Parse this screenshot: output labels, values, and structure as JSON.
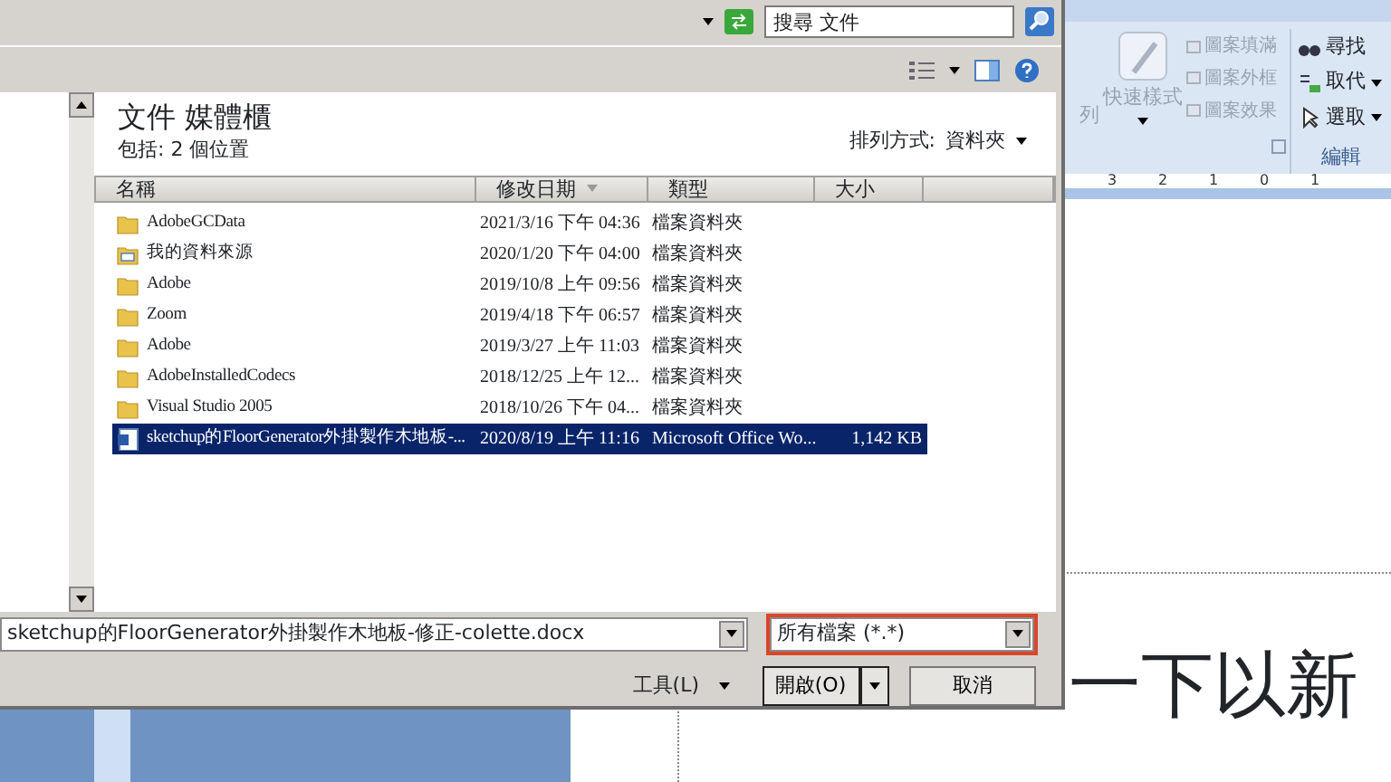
{
  "dialog": {
    "search": {
      "placeholder": "搜尋 文件"
    },
    "library": {
      "title": "文件 媒體櫃",
      "subtitle": "包括: 2 個位置",
      "arrange_label": "排列方式:",
      "arrange_value": "資料夾"
    },
    "columns": [
      {
        "label": "名稱",
        "sorted": false
      },
      {
        "label": "修改日期",
        "sorted": true
      },
      {
        "label": "類型",
        "sorted": false
      },
      {
        "label": "大小",
        "sorted": false
      }
    ],
    "rows": [
      {
        "kind": "folder",
        "name": "AdobeGCData",
        "modified": "2021/3/16 下午 04:36",
        "type": "檔案資料夾",
        "selected": false
      },
      {
        "kind": "special",
        "name": "我的資料來源",
        "modified": "2020/1/20 下午 04:00",
        "type": "檔案資料夾",
        "selected": false
      },
      {
        "kind": "folder",
        "name": "Adobe",
        "modified": "2019/10/8 上午 09:56",
        "type": "檔案資料夾",
        "selected": false
      },
      {
        "kind": "folder",
        "name": "Zoom",
        "modified": "2019/4/18 下午 06:57",
        "type": "檔案資料夾",
        "selected": false
      },
      {
        "kind": "folder",
        "name": "Adobe",
        "modified": "2019/3/27 上午 11:03",
        "type": "檔案資料夾",
        "selected": false
      },
      {
        "kind": "folder",
        "name": "AdobeInstalledCodecs",
        "modified": "2018/12/25 上午 12...",
        "type": "檔案資料夾",
        "selected": false
      },
      {
        "kind": "folder",
        "name": "Visual Studio 2005",
        "modified": "2018/10/26 下午 04...",
        "type": "檔案資料夾",
        "selected": false
      },
      {
        "kind": "document",
        "name": "sketchup的FloorGenerator外掛製作木地板-...",
        "modified": "2020/8/19 上午 11:16",
        "type": "Microsoft Office Wo...",
        "size": "1,142 KB",
        "selected": true
      }
    ],
    "file_name": {
      "value": "sketchup的FloorGenerator外掛製作木地板-修正-colette.docx"
    },
    "file_type": {
      "value": "所有檔案 (*.*)",
      "highlighted": true
    },
    "tools_button": "工具(L)",
    "open_button": "開啟(O)",
    "cancel_button": "取消"
  },
  "word": {
    "ribbon": {
      "cut_label": "列",
      "quick_styles": "快速樣式",
      "shape_items": [
        {
          "label": "圖案填滿",
          "disabled": true
        },
        {
          "label": "圖案外框",
          "disabled": true
        },
        {
          "label": "圖案效果",
          "disabled": true
        }
      ],
      "edit_items": [
        {
          "kind": "find",
          "label": "尋找"
        },
        {
          "kind": "replace",
          "label": "取代"
        },
        {
          "kind": "select",
          "label": "選取"
        }
      ],
      "edit_group": "編輯"
    },
    "ruler": [
      "3",
      "2",
      "1",
      "0",
      "1"
    ],
    "document_text": "一下以新"
  }
}
